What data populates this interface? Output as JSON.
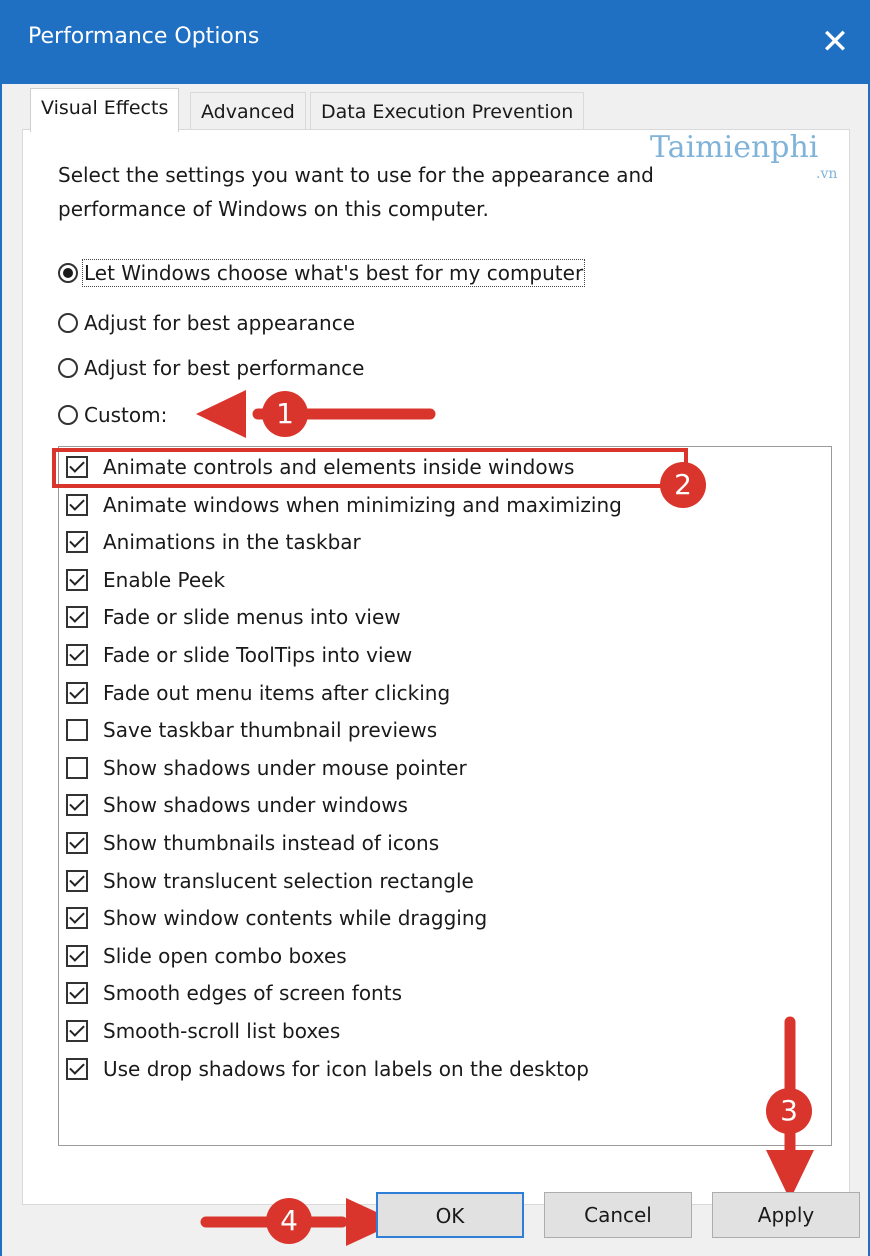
{
  "window": {
    "title": "Performance Options",
    "close_glyph": "✕"
  },
  "tabs": [
    {
      "label": "Visual Effects",
      "active": true
    },
    {
      "label": "Advanced",
      "active": false
    },
    {
      "label": "Data Execution Prevention",
      "active": false
    }
  ],
  "watermark": {
    "text": "Taimienphi",
    "sub": ".vn"
  },
  "description": "Select the settings you want to use for the appearance and performance of Windows on this computer.",
  "radios": [
    {
      "label": "Let Windows choose what's best for my computer",
      "selected": true
    },
    {
      "label": "Adjust for best appearance",
      "selected": false
    },
    {
      "label": "Adjust for best performance",
      "selected": false
    },
    {
      "label": "Custom:",
      "selected": false
    }
  ],
  "options": [
    {
      "label": "Animate controls and elements inside windows",
      "checked": true
    },
    {
      "label": "Animate windows when minimizing and maximizing",
      "checked": true
    },
    {
      "label": "Animations in the taskbar",
      "checked": true
    },
    {
      "label": "Enable Peek",
      "checked": true
    },
    {
      "label": "Fade or slide menus into view",
      "checked": true
    },
    {
      "label": "Fade or slide ToolTips into view",
      "checked": true
    },
    {
      "label": "Fade out menu items after clicking",
      "checked": true
    },
    {
      "label": "Save taskbar thumbnail previews",
      "checked": false
    },
    {
      "label": "Show shadows under mouse pointer",
      "checked": false
    },
    {
      "label": "Show shadows under windows",
      "checked": true
    },
    {
      "label": "Show thumbnails instead of icons",
      "checked": true
    },
    {
      "label": "Show translucent selection rectangle",
      "checked": true
    },
    {
      "label": "Show window contents while dragging",
      "checked": true
    },
    {
      "label": "Slide open combo boxes",
      "checked": true
    },
    {
      "label": "Smooth edges of screen fonts",
      "checked": true
    },
    {
      "label": "Smooth-scroll list boxes",
      "checked": true
    },
    {
      "label": "Use drop shadows for icon labels on the desktop",
      "checked": true
    }
  ],
  "buttons": {
    "ok": "OK",
    "cancel": "Cancel",
    "apply": "Apply"
  },
  "annotations": [
    "1",
    "2",
    "3",
    "4"
  ],
  "colors": {
    "title_bar": "#1f6fc2",
    "annotation_red": "#d9352c",
    "watermark": "#7fb3d9"
  }
}
